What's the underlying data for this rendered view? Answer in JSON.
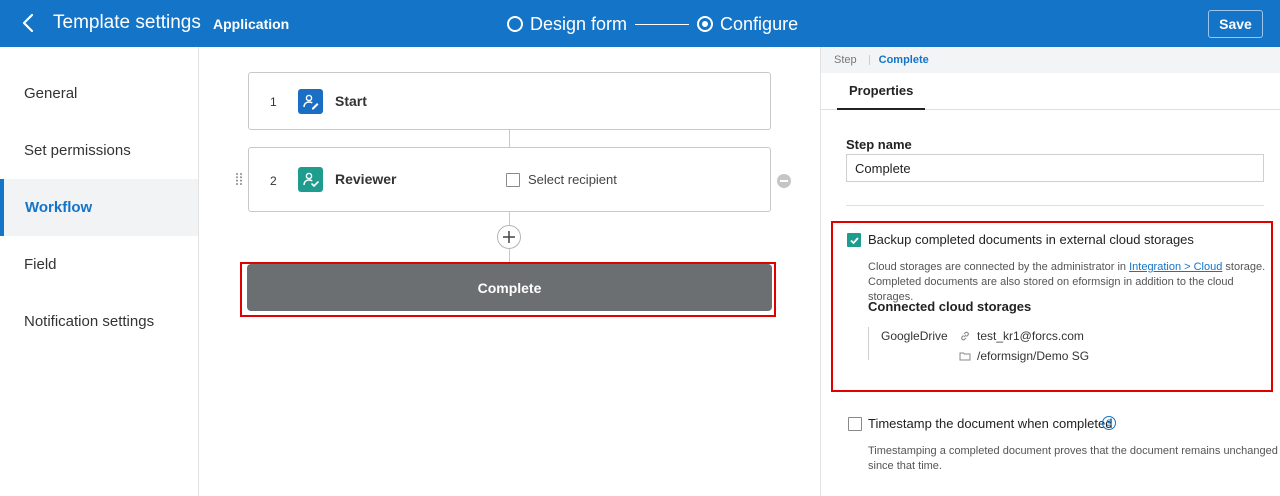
{
  "header": {
    "title": "Template settings",
    "subtitle": "Application",
    "steps": [
      {
        "label": "Design form",
        "active": false
      },
      {
        "label": "Configure",
        "active": true
      }
    ],
    "save_label": "Save",
    "colors": {
      "bar": "#1474c8"
    }
  },
  "sidebar": {
    "items": [
      {
        "label": "General"
      },
      {
        "label": "Set permissions"
      },
      {
        "label": "Workflow",
        "active": true
      },
      {
        "label": "Field"
      },
      {
        "label": "Notification settings"
      }
    ]
  },
  "workflow": {
    "steps": [
      {
        "number": "1",
        "label": "Start",
        "icon": "user-edit-icon",
        "color": "#1a6fc4"
      },
      {
        "number": "2",
        "label": "Reviewer",
        "icon": "user-check-icon",
        "color": "#1e9c8d",
        "select_recipient_label": "Select recipient"
      }
    ],
    "complete_label": "Complete"
  },
  "panel": {
    "breadcrumb": {
      "parent": "Step",
      "current": "Complete"
    },
    "tab": "Properties",
    "step_name_label": "Step name",
    "step_name_value": "Complete",
    "backup": {
      "checked": true,
      "title": "Backup completed documents in external cloud storages",
      "desc_prefix": "Cloud storages are connected by the administrator in ",
      "desc_link": "Integration > Cloud",
      "desc_suffix": " storage.",
      "desc_line2": "Completed documents are also stored on eformsign in addition to the cloud storages.",
      "connected_title": "Connected cloud storages",
      "storage_name": "GoogleDrive",
      "account": "test_kr1@forcs.com",
      "folder": "/eformsign/Demo SG"
    },
    "timestamp": {
      "checked": false,
      "title": "Timestamp the document when completed",
      "coin_symbol": "$",
      "desc_line1": "Timestamping a completed document proves that the document remains unchanged",
      "desc_line2": "since that time."
    }
  }
}
